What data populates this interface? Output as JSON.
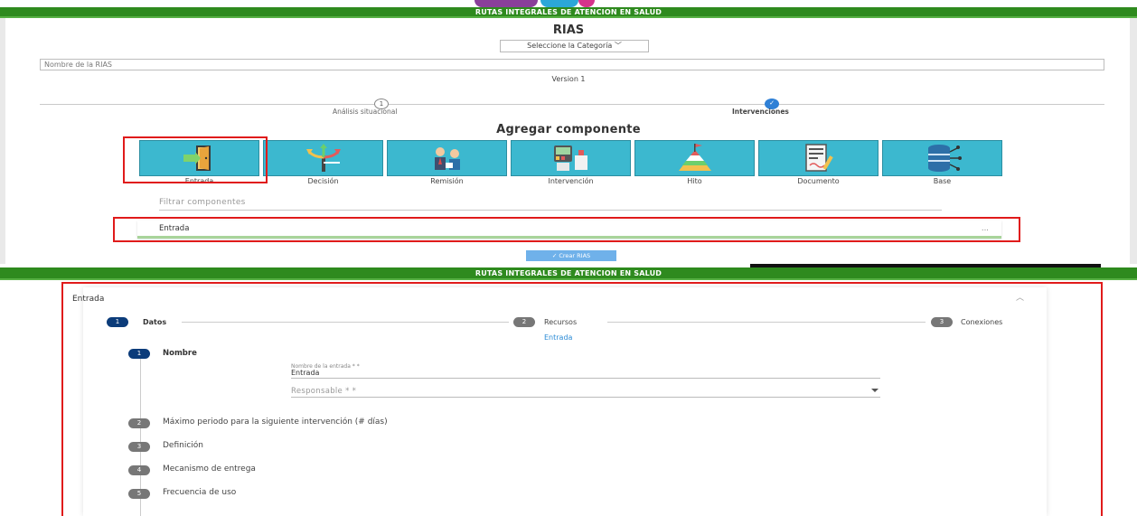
{
  "banner": {
    "title": "RUTAS INTEGRALES DE ATENCION EN SALUD"
  },
  "header": {
    "title": "RIAS",
    "category_select": "Seleccione la Categoría",
    "name_placeholder": "Nombre de la RIAS",
    "version": "Version 1"
  },
  "stepper": {
    "steps": [
      {
        "number": "1",
        "label": "Análisis situacional"
      },
      {
        "number": "✓",
        "label": "Intervenciones"
      }
    ]
  },
  "components": {
    "title": "Agregar componente",
    "items": [
      {
        "label": "Entrada",
        "icon": "door-enter-icon"
      },
      {
        "label": "Decisión",
        "icon": "arrows-split-icon"
      },
      {
        "label": "Remisión",
        "icon": "people-referral-icon"
      },
      {
        "label": "Intervención",
        "icon": "medical-equipment-icon"
      },
      {
        "label": "Hito",
        "icon": "pyramid-flag-icon"
      },
      {
        "label": "Documento",
        "icon": "document-sign-icon"
      },
      {
        "label": "Base",
        "icon": "database-icon"
      }
    ],
    "filter_placeholder": "Filtrar componentes",
    "added_item": "Entrada",
    "added_item_dots": "...",
    "create_button": "✓ Crear RIAS"
  },
  "detail": {
    "panel_title": "Entrada",
    "caret": "︿",
    "top_steps": [
      {
        "number": "1",
        "label": "Datos"
      },
      {
        "number": "2",
        "label": "Recursos"
      },
      {
        "number": "3",
        "label": "Conexiones"
      }
    ],
    "sub_title": "Entrada",
    "vertical_steps": [
      {
        "number": "1",
        "label": "Nombre"
      },
      {
        "number": "2",
        "label": "Máximo periodo para la siguiente intervención (# días)"
      },
      {
        "number": "3",
        "label": "Definición"
      },
      {
        "number": "4",
        "label": "Mecanismo de entrega"
      },
      {
        "number": "5",
        "label": "Frecuencia de uso"
      }
    ],
    "name_field_label": "Nombre de la entrada * *",
    "name_field_value": "Entrada",
    "responsable_placeholder": "Responsable * *"
  },
  "colors": {
    "banner": "#2e8a1e",
    "tile": "#3cb8cf",
    "highlight": "#e01b1b",
    "step_active": "#0c3c7a",
    "link": "#2b8bd6"
  }
}
